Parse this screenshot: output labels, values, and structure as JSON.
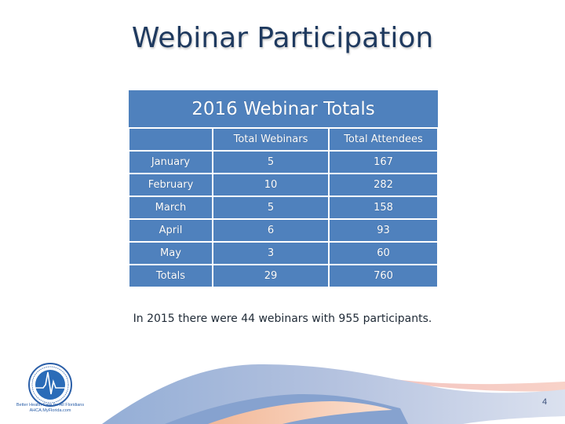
{
  "slide": {
    "title": "Webinar Participation",
    "page_number": "4"
  },
  "table": {
    "title": "2016 Webinar Totals",
    "columns": [
      "",
      "Total Webinars",
      "Total Attendees"
    ],
    "rows": [
      {
        "month": "January",
        "webinars": "5",
        "attendees": "167"
      },
      {
        "month": "February",
        "webinars": "10",
        "attendees": "282"
      },
      {
        "month": "March",
        "webinars": "5",
        "attendees": "158"
      },
      {
        "month": "April",
        "webinars": "6",
        "attendees": "93"
      },
      {
        "month": "May",
        "webinars": "3",
        "attendees": "60"
      },
      {
        "month": "Totals",
        "webinars": "29",
        "attendees": "760"
      }
    ]
  },
  "note": "In 2015 there were 44 webinars with 955 participants.",
  "logo": {
    "tagline": "Better Health Care for All Floridians",
    "subline": "AHCA.MyFlorida.com"
  },
  "colors": {
    "table_fill": "#4f81bd",
    "title_text": "#1f3a5f"
  }
}
